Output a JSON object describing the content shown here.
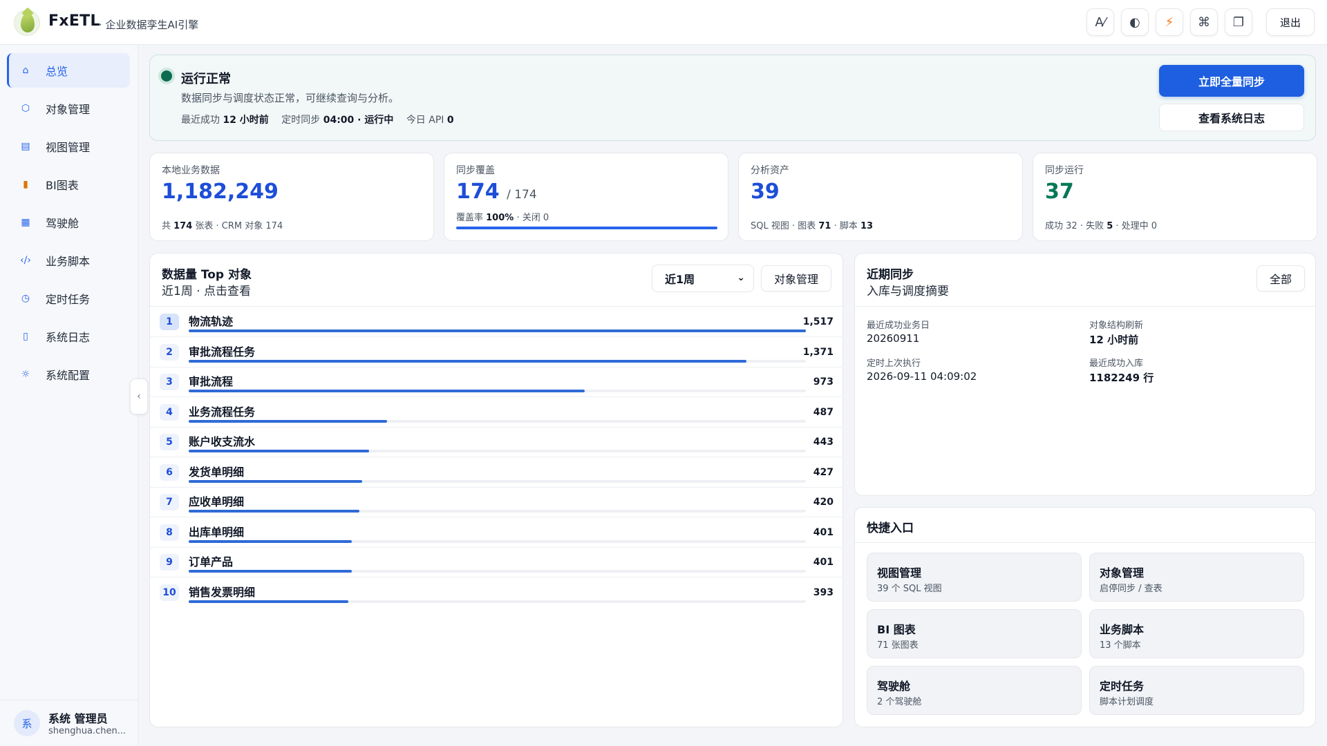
{
  "header": {
    "brand": "FxETL",
    "subtitle": "· 企业数据孪生AI引擎",
    "tools": [
      {
        "name": "ai-icon",
        "glyph": "A⁄"
      },
      {
        "name": "contrast-icon",
        "glyph": "◐"
      },
      {
        "name": "lightning-icon",
        "glyph": "⚡"
      },
      {
        "name": "command-icon",
        "glyph": "⌘"
      },
      {
        "name": "window-icon",
        "glyph": "❐"
      }
    ],
    "logout": "退出"
  },
  "sidebar": {
    "items": [
      {
        "label": "总览",
        "icon": "⌂",
        "active": true
      },
      {
        "label": "对象管理",
        "icon": "⬡"
      },
      {
        "label": "视图管理",
        "icon": "▤"
      },
      {
        "label": "BI图表",
        "icon": "▮"
      },
      {
        "label": "驾驶舱",
        "icon": "▦"
      },
      {
        "label": "业务脚本",
        "icon": "‹/›"
      },
      {
        "label": "定时任务",
        "icon": "◷"
      },
      {
        "label": "系统日志",
        "icon": "▯"
      },
      {
        "label": "系统配置",
        "icon": "☼"
      }
    ],
    "user": {
      "avatar": "系",
      "name": "系统 管理员",
      "email": "shenghua.chen..."
    },
    "collapse_glyph": "‹"
  },
  "status": {
    "title": "运行正常",
    "desc": "数据同步与调度状态正常，可继续查询与分析。",
    "last_success_label": "最近成功",
    "last_success_value": "12 小时前",
    "schedule_label": "定时同步",
    "schedule_value": "04:00 · 运行中",
    "api_label": "今日 API",
    "api_value": "0",
    "primary_btn": "立即全量同步",
    "secondary_btn": "查看系统日志"
  },
  "stats": {
    "local": {
      "label": "本地业务数据",
      "value": "1,182,249",
      "sub_pre": "共 ",
      "sub_bold": "174",
      "sub_post": " 张表 · CRM 对象 174"
    },
    "coverage": {
      "label": "同步覆盖",
      "value": "174",
      "total": "/ 174",
      "sub_pre": "覆盖率 ",
      "sub_bold": "100%",
      "sub_post": " · 关闭 0",
      "fraction": 1.0
    },
    "assets": {
      "label": "分析资产",
      "value": "39",
      "sub_pre": "SQL 视图 · 图表 ",
      "sub_bold": "71",
      "sub_mid": " · 脚本 ",
      "sub_bold2": "13"
    },
    "runs": {
      "label": "同步运行",
      "value": "37",
      "sub_pre": "成功 32 · 失败 ",
      "sub_bold": "5",
      "sub_post": " · 处理中 0"
    }
  },
  "top_objects": {
    "title": "数据量 Top 对象",
    "subtitle": "近1周 · 点击查看",
    "select_value": "近1周",
    "manage_btn": "对象管理",
    "max": 1517,
    "rows": [
      {
        "rank": "1",
        "name": "物流轨迹",
        "value": 1517
      },
      {
        "rank": "2",
        "name": "审批流程任务",
        "value": 1371
      },
      {
        "rank": "3",
        "name": "审批流程",
        "value": 973
      },
      {
        "rank": "4",
        "name": "业务流程任务",
        "value": 487
      },
      {
        "rank": "5",
        "name": "账户收支流水",
        "value": 443
      },
      {
        "rank": "6",
        "name": "发货单明细",
        "value": 427
      },
      {
        "rank": "7",
        "name": "应收单明细",
        "value": 420
      },
      {
        "rank": "8",
        "name": "出库单明细",
        "value": 401
      },
      {
        "rank": "9",
        "name": "订单产品",
        "value": 401
      },
      {
        "rank": "10",
        "name": "销售发票明细",
        "value": 393
      }
    ]
  },
  "recent_sync": {
    "title": "近期同步",
    "subtitle": "入库与调度摘要",
    "all_btn": "全部",
    "items": [
      {
        "label": "最近成功业务日",
        "value": "20260911",
        "bold": false
      },
      {
        "label": "对象结构刷新",
        "value": "12 小时前",
        "bold": true
      },
      {
        "label": "定时上次执行",
        "value": "2026-09-11 04:09:02",
        "bold": false
      },
      {
        "label": "最近成功入库",
        "value": "1182249 行",
        "bold": true
      }
    ]
  },
  "quick": {
    "title": "快捷入口",
    "items": [
      {
        "title": "视图管理",
        "sub": "39 个 SQL 视图"
      },
      {
        "title": "对象管理",
        "sub": "启停同步 / 查表"
      },
      {
        "title": "BI 图表",
        "sub": "71 张图表"
      },
      {
        "title": "业务脚本",
        "sub": "13 个脚本"
      },
      {
        "title": "驾驶舱",
        "sub": "2 个驾驶舱"
      },
      {
        "title": "定时任务",
        "sub": "脚本计划调度"
      }
    ]
  },
  "colors": {
    "accent": "#1d5fe0",
    "success": "#047857",
    "status_dot": "#0f6b4f",
    "lightning": "#f97316"
  }
}
